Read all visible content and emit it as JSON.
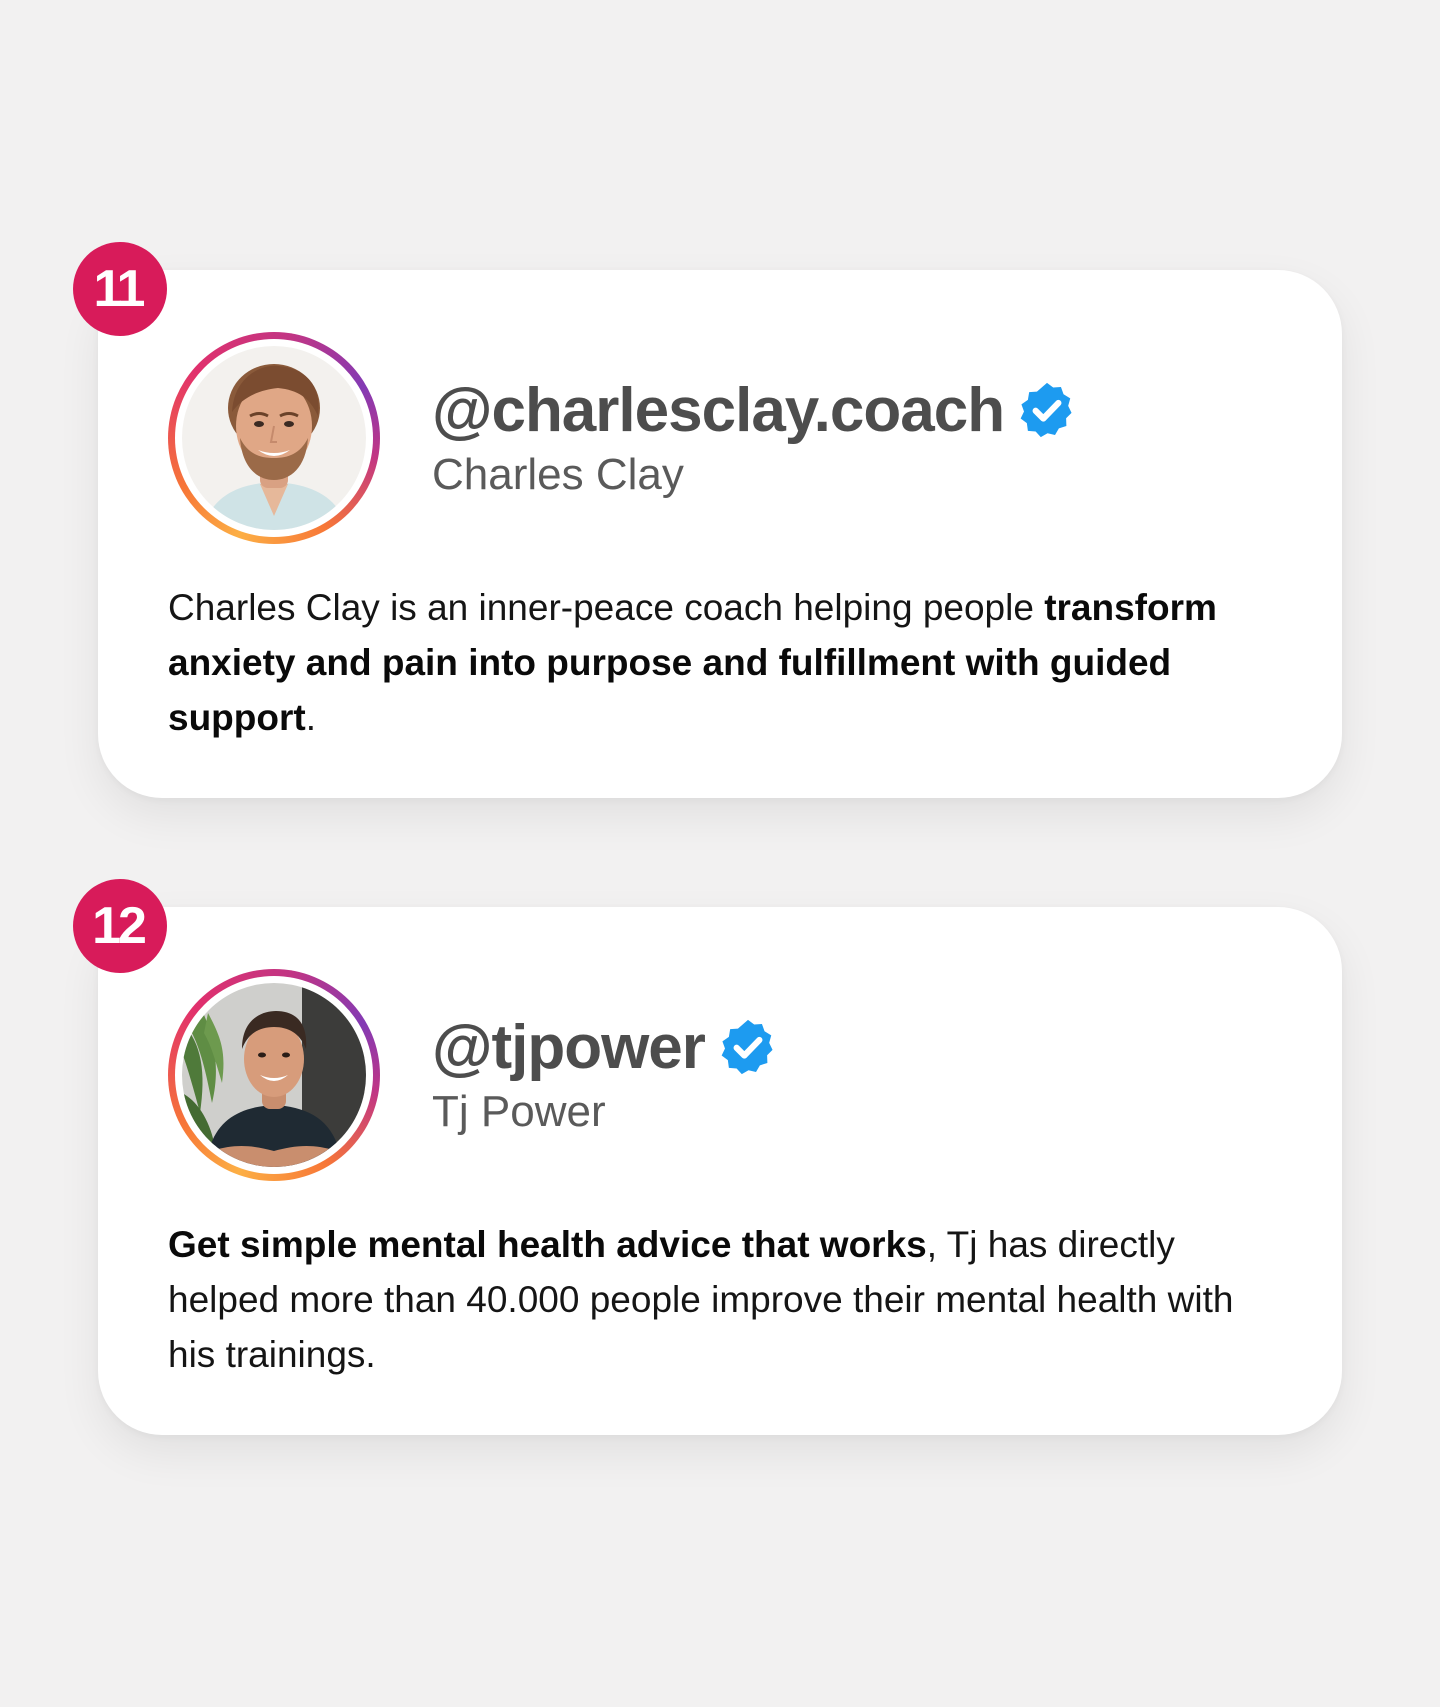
{
  "colors": {
    "background": "#f2f1f1",
    "card": "#ffffff",
    "badge": "#d81b5a",
    "verified": "#1d9bf0",
    "handle_text": "#4d4d4d",
    "name_text": "#5a5a5a"
  },
  "profiles": [
    {
      "rank": "11",
      "handle": "@charlesclay.coach",
      "verified_icon": "verified-badge-icon",
      "name": "Charles Clay",
      "avatar_icon": "profile-photo",
      "bio": {
        "text_1": "Charles Clay is an inner-peace coach helping people ",
        "bold_1": "transform anxiety and pain into purpose and fulfillment with guided support",
        "text_2": "."
      }
    },
    {
      "rank": "12",
      "handle": "@tjpower",
      "verified_icon": "verified-badge-icon",
      "name": "Tj Power",
      "avatar_icon": "profile-photo",
      "bio": {
        "bold_1": "Get simple mental health advice that works",
        "text_1": ", Tj has directly helped more than 40.000 people improve their mental health with his trainings."
      }
    }
  ]
}
